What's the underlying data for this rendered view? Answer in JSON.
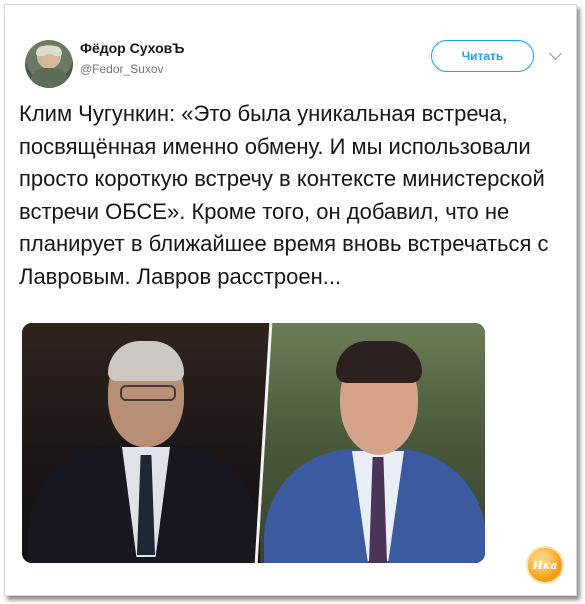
{
  "tweet": {
    "author_name": "Фёдор СуховЪ",
    "author_handle": "@Fedor_Suxov",
    "follow_label": "Читать",
    "text": "Клим Чугункин: «Это была уникальная встреча, посвящённая именно обмену. И мы использовали просто короткую встречу в контексте министерской встречи ОБСЕ». Кроме того, он добавил, что не планирует в ближайшее время вновь встречаться с Лавровым. Лавров расстроен..."
  },
  "watermark": {
    "text": "Ика"
  },
  "colors": {
    "accent": "#1da1f2",
    "text": "#14171a",
    "secondary": "#657786"
  },
  "icons": {
    "menu": "chevron-down-icon"
  }
}
